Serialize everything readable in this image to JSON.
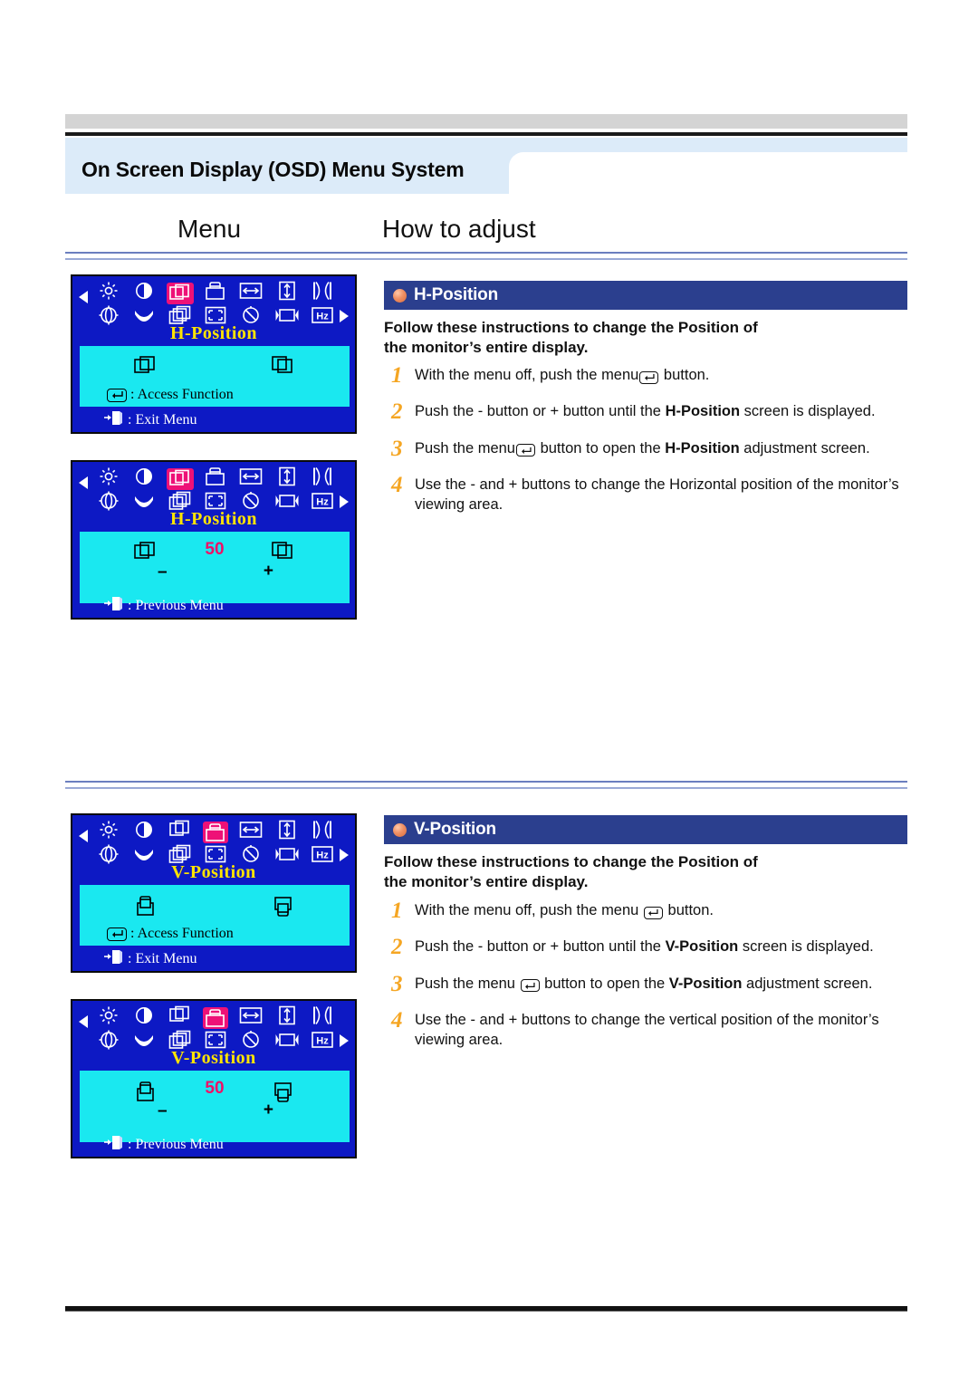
{
  "header": {
    "title": "On Screen Display (OSD) Menu System",
    "col_menu": "Menu",
    "col_how": "How to adjust"
  },
  "osd": {
    "h_menu": {
      "label": "H-Position",
      "access_text": ": Access Function",
      "exit_text": ": Exit Menu",
      "highlight_index": 2,
      "highlight_row": 0
    },
    "h_adjust": {
      "label": "H-Position",
      "value": "50",
      "minus": "–",
      "plus": "+",
      "previous_text": ": Previous Menu",
      "highlight_index": 2,
      "highlight_row": 0
    },
    "v_menu": {
      "label": "V-Position",
      "access_text": ": Access Function",
      "exit_text": ": Exit Menu",
      "highlight_index": 3,
      "highlight_row": 0
    },
    "v_adjust": {
      "label": "V-Position",
      "value": "50",
      "minus": "–",
      "plus": "+",
      "previous_text": ": Previous Menu",
      "highlight_index": 3,
      "highlight_row": 0
    },
    "icon_names_row1": [
      "brightness-icon",
      "contrast-icon",
      "h-position-icon",
      "v-position-icon",
      "h-size-icon",
      "v-size-icon",
      "pincushion-icon"
    ],
    "icon_names_row2": [
      "rotation-icon",
      "trapezoid-icon",
      "parallelogram-icon",
      "corner-icon",
      "degauss-icon",
      "recall-icon",
      "frequency-icon"
    ]
  },
  "sections": [
    {
      "id": "h",
      "title": "H-Position",
      "intro_line1": "Follow these instructions to change the  Position of",
      "intro_line2": "the monitor’s entire display.",
      "steps": [
        {
          "num": "1",
          "pre": "With the menu off, push the menu",
          "key": "↵",
          "post": " button."
        },
        {
          "num": "2",
          "pre": "Push the  - button or  + button until the  ",
          "bold": "H-Position",
          "post": " screen is displayed."
        },
        {
          "num": "3",
          "pre": "Push the menu",
          "key": "↵",
          "mid": " button to open the ",
          "bold": "H-Position",
          "post": " adjustment screen."
        },
        {
          "num": "4",
          "pre": "Use the  - and  + buttons to change the Horizontal position of the monitor’s viewing area."
        }
      ]
    },
    {
      "id": "v",
      "title": "V-Position",
      "intro_line1": "Follow these instructions to change the  Position of",
      "intro_line2": "the monitor’s entire display.",
      "steps": [
        {
          "num": "1",
          "pre": "With the menu off, push the menu ",
          "key": "↵",
          "post": " button."
        },
        {
          "num": "2",
          "pre": "Push the  - button or  + button until the  ",
          "bold": "V-Position",
          "post": "  screen is displayed."
        },
        {
          "num": "3",
          "pre": "Push the menu ",
          "key": "↵",
          "mid": " button to open the ",
          "bold": "V-Position",
          "post": " adjustment screen."
        },
        {
          "num": "4",
          "pre": "Use the  - and  + buttons to change the vertical position of the monitor’s viewing area."
        }
      ]
    }
  ],
  "colors": {
    "section_header_bg": "#2b3f8e",
    "bullet": "#ef8f63",
    "step_number": "#f5a623",
    "osd_bg": "#0d19c4",
    "osd_screen": "#1ae8f0",
    "osd_label": "#ffe400",
    "osd_highlight": "#ee1177",
    "osd_value": "#ee1166",
    "title_band": "#dcebf9"
  }
}
